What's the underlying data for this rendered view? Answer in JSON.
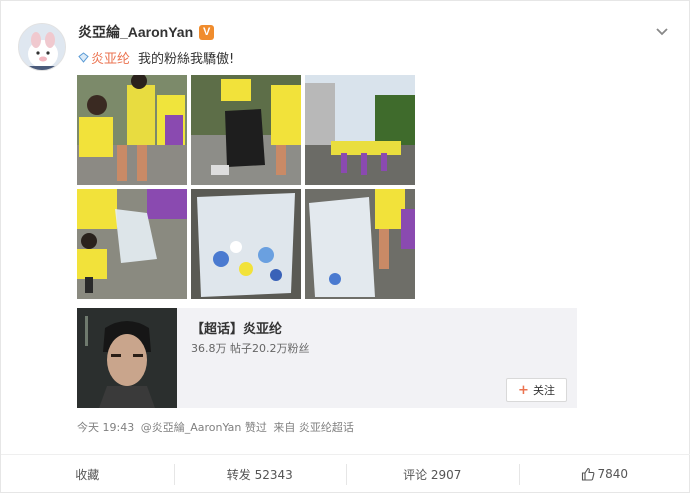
{
  "user": {
    "name": "炎亞綸_AaronYan",
    "badge": "V"
  },
  "post": {
    "topic": "炎亚纶",
    "text": "我的粉絲我驕傲!"
  },
  "photos_alt": [
    "fans-picking-litter",
    "trash-bag-on-street",
    "street-procession",
    "child-holding-bag",
    "bag-of-bottles",
    "full-trash-bag"
  ],
  "repost": {
    "title": "【超话】炎亚纶",
    "stats": "36.8万 帖子20.2万粉丝",
    "follow_label": "关注"
  },
  "meta": {
    "time": "今天 19:43",
    "liked_by": "@炎亞綸_AaronYan 赞过",
    "source": "来自 炎亚纶超话"
  },
  "actions": {
    "favorite": "收藏",
    "repost": "转发 52343",
    "comment": "评论 2907",
    "like": "7840"
  },
  "colors": {
    "accent": "#eb7350",
    "verified": "#f08c2d"
  }
}
